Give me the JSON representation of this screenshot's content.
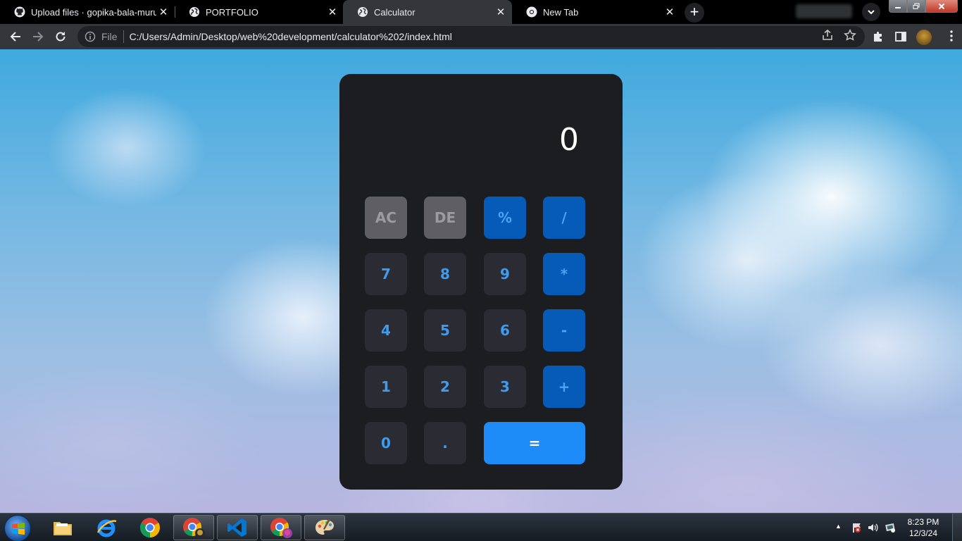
{
  "browser": {
    "tabs": [
      {
        "title": "Upload files · gopika-bala-murug",
        "active": false,
        "favicon": "github-icon"
      },
      {
        "title": "PORTFOLIO",
        "active": false,
        "favicon": "globe-icon"
      },
      {
        "title": "Calculator",
        "active": true,
        "favicon": "globe-icon"
      },
      {
        "title": "New Tab",
        "active": false,
        "favicon": "chrome-icon"
      }
    ],
    "new_tab_label": "+",
    "close_glyph": "✕",
    "address": {
      "scheme_label": "File",
      "url": "C:/Users/Admin/Desktop/web%20development/calculator%202/index.html"
    }
  },
  "calculator": {
    "display": "0",
    "keys": {
      "ac": "AC",
      "de": "DE",
      "percent": "%",
      "divide": "/",
      "seven": "7",
      "eight": "8",
      "nine": "9",
      "multiply": "*",
      "four": "4",
      "five": "5",
      "six": "6",
      "minus": "-",
      "one": "1",
      "two": "2",
      "three": "3",
      "plus": "+",
      "zero": "0",
      "dot": ".",
      "equals": "="
    }
  },
  "taskbar": {
    "clock_time": "8:23 PM",
    "clock_date": "12/3/24",
    "tray_expand": "▲"
  }
}
